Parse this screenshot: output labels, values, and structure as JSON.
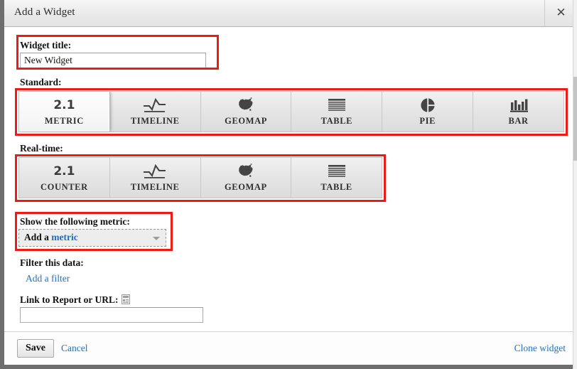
{
  "window": {
    "title": "Add a Widget",
    "close_icon": "close-icon"
  },
  "form": {
    "widget_title_label": "Widget title:",
    "widget_title_value": "New Widget",
    "widget_title_placeholder": "",
    "standard_label": "Standard:",
    "realtime_label": "Real-time:",
    "metric_label": "Show the following metric:",
    "metric_prefix": "Add a ",
    "metric_link": "metric",
    "filter_label": "Filter this data:",
    "add_filter_link": "Add a filter",
    "link_label": "Link to Report or URL:",
    "link_value": "",
    "link_placeholder": ""
  },
  "standard_tiles": [
    {
      "label": "METRIC",
      "icon": "number-2-1-icon",
      "glyph": "2.1",
      "selected": true
    },
    {
      "label": "TIMELINE",
      "icon": "timeline-icon",
      "glyph": "",
      "selected": false
    },
    {
      "label": "GEOMAP",
      "icon": "geomap-icon",
      "glyph": "",
      "selected": false
    },
    {
      "label": "TABLE",
      "icon": "table-icon",
      "glyph": "",
      "selected": false
    },
    {
      "label": "PIE",
      "icon": "pie-chart-icon",
      "glyph": "",
      "selected": false
    },
    {
      "label": "BAR",
      "icon": "bar-chart-icon",
      "glyph": "",
      "selected": false
    }
  ],
  "realtime_tiles": [
    {
      "label": "COUNTER",
      "icon": "number-2-1-icon",
      "glyph": "2.1",
      "selected": false
    },
    {
      "label": "TIMELINE",
      "icon": "timeline-icon",
      "glyph": "",
      "selected": false
    },
    {
      "label": "GEOMAP",
      "icon": "geomap-icon",
      "glyph": "",
      "selected": false
    },
    {
      "label": "TABLE",
      "icon": "table-icon",
      "glyph": "",
      "selected": false
    }
  ],
  "footer": {
    "save_label": "Save",
    "cancel_label": "Cancel",
    "clone_label": "Clone widget"
  },
  "colors": {
    "annotation": "#ee1b15",
    "link": "#1f6fc4",
    "window_border": "#6e6e6e"
  }
}
